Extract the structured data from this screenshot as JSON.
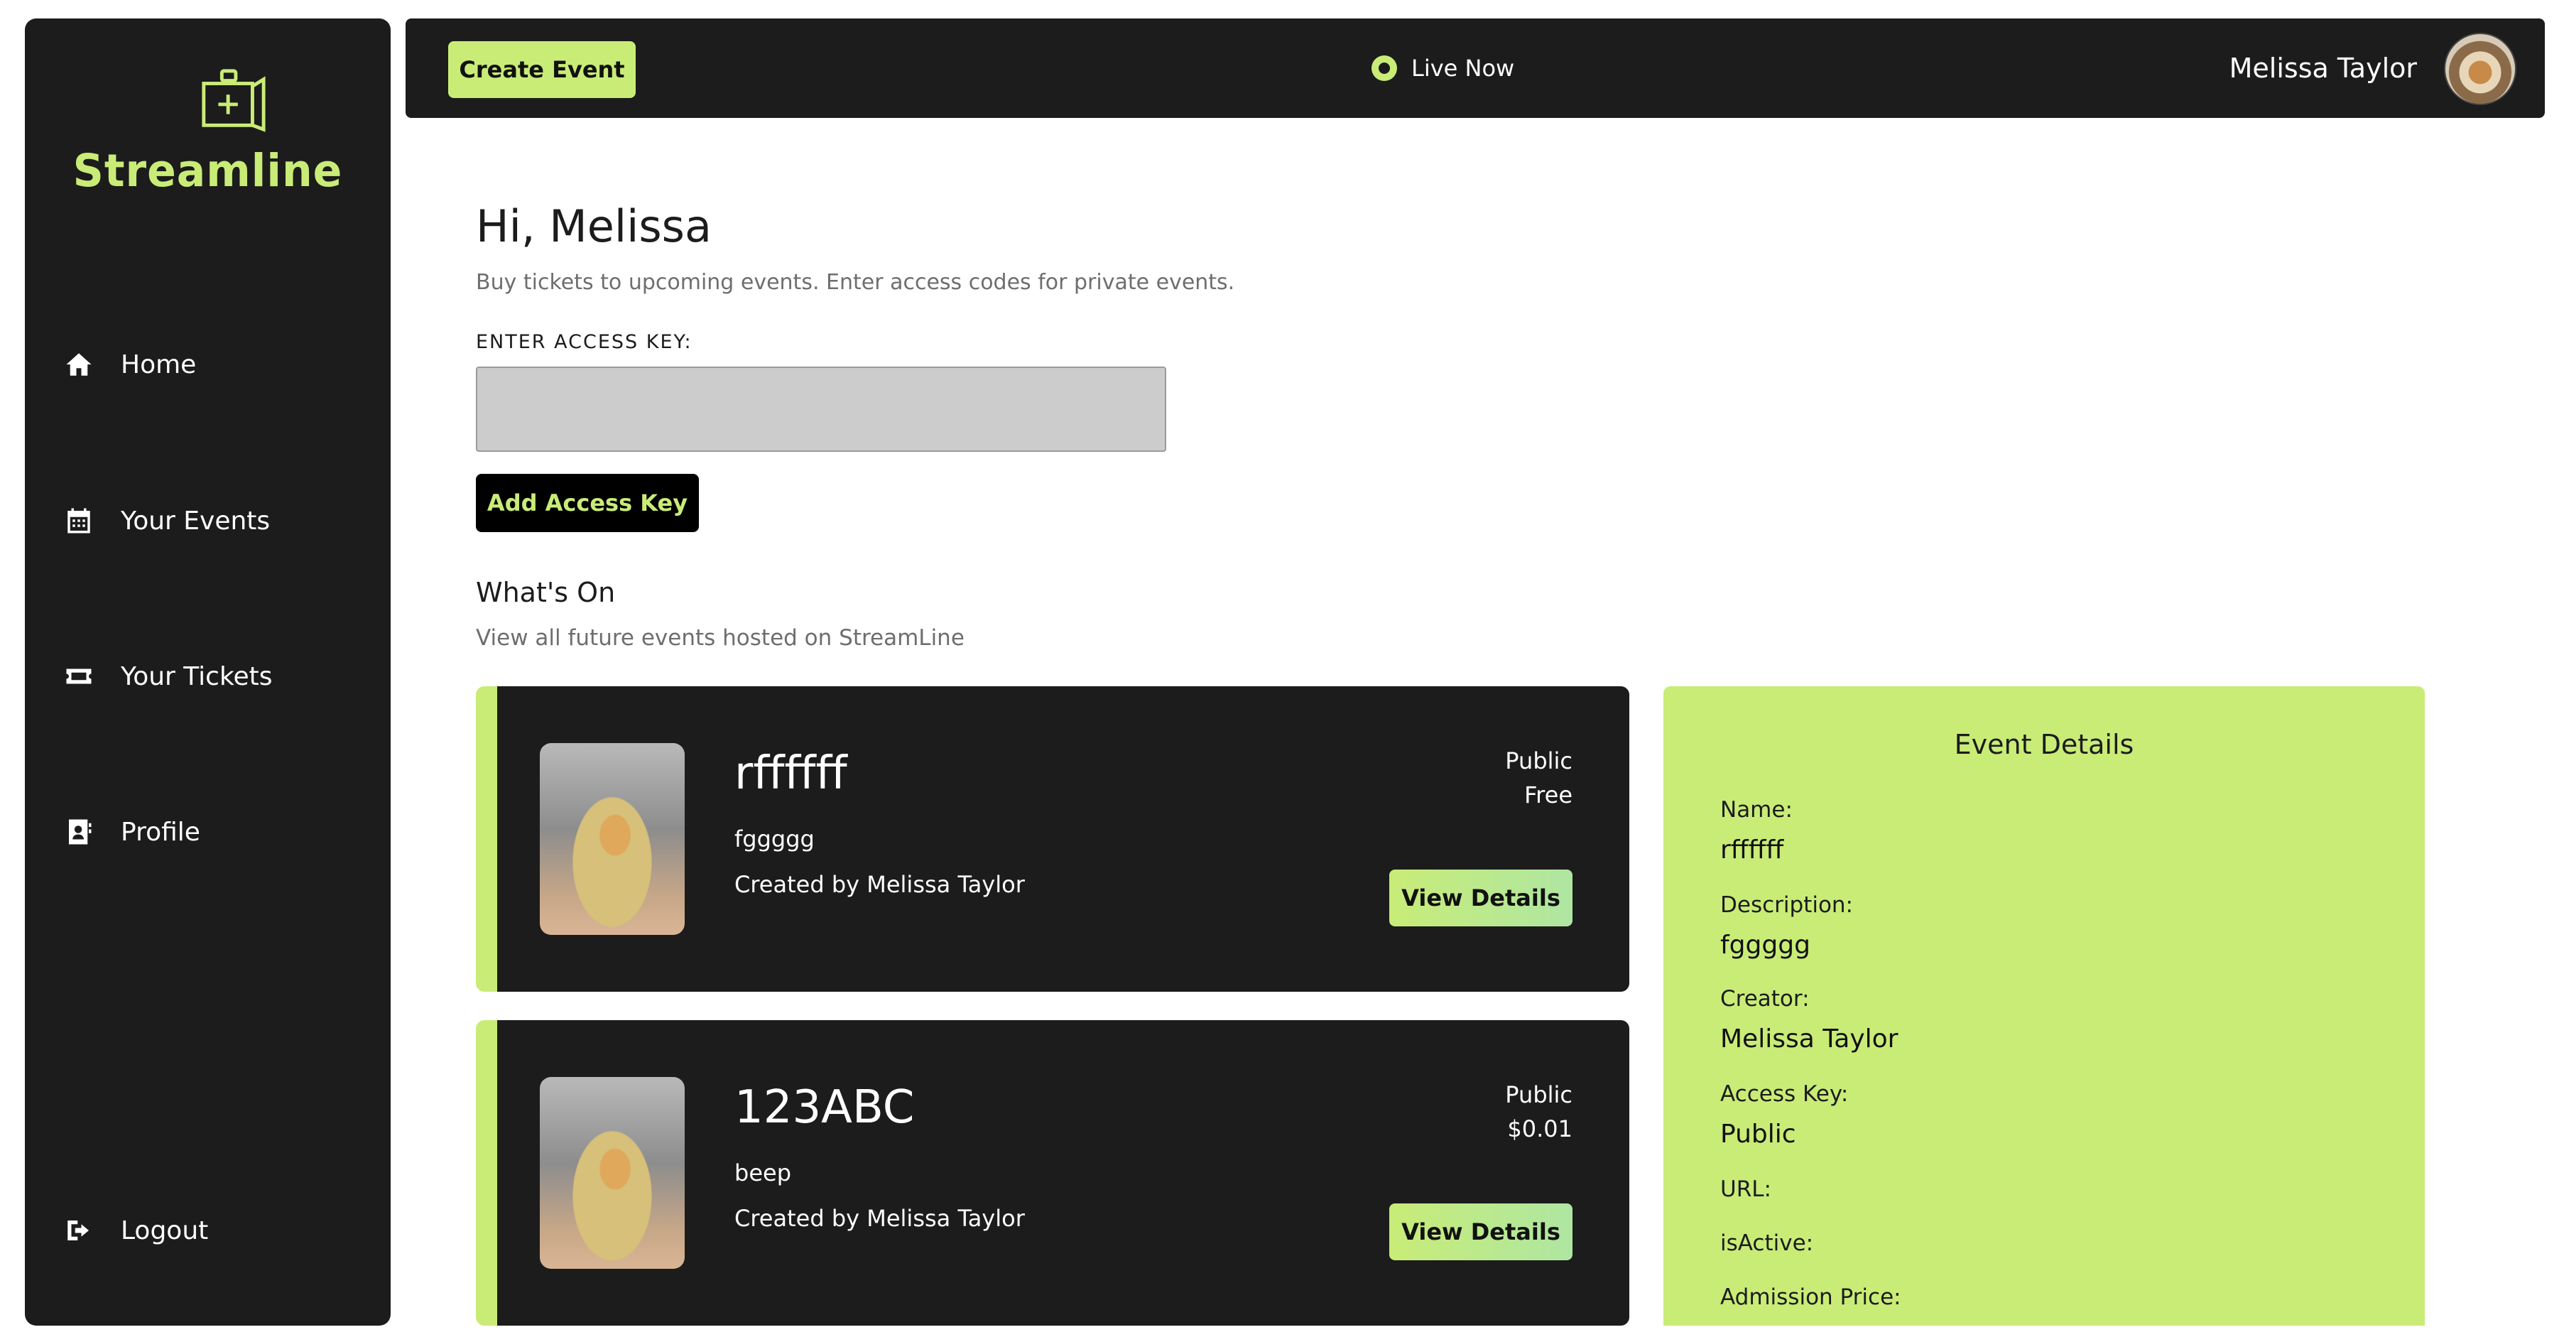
{
  "sidebar": {
    "logo_text": "Streamline",
    "items": [
      {
        "label": "Home",
        "icon": "home-icon"
      },
      {
        "label": "Your Events",
        "icon": "calendar-icon"
      },
      {
        "label": "Your Tickets",
        "icon": "ticket-icon"
      },
      {
        "label": "Profile",
        "icon": "contact-card-icon"
      },
      {
        "label": "Logout",
        "icon": "logout-icon"
      }
    ]
  },
  "header": {
    "create_label": "Create Event",
    "live_label": "Live Now",
    "user_name": "Melissa Taylor"
  },
  "main": {
    "greeting": "Hi, Melissa",
    "subtitle": "Buy tickets to upcoming events. Enter access codes for private events.",
    "access_label": "ENTER ACCESS KEY:",
    "access_value": "",
    "add_key_label": "Add Access Key",
    "section_title": "What's On",
    "section_sub": "View all future events hosted on StreamLine"
  },
  "events": [
    {
      "title": "rffffff",
      "description": "fggggg",
      "creator": "Created by Melissa Taylor",
      "visibility": "Public",
      "price": "Free",
      "button": "View Details"
    },
    {
      "title": "123ABC",
      "description": "beep",
      "creator": "Created by Melissa Taylor",
      "visibility": "Public",
      "price": "$0.01",
      "button": "View Details"
    }
  ],
  "details": {
    "title": "Event Details",
    "name_label": "Name:",
    "name_value": "rffffff",
    "desc_label": "Description:",
    "desc_value": "fggggg",
    "creator_label": "Creator:",
    "creator_value": "Melissa Taylor",
    "access_label": "Access Key:",
    "access_value": "Public",
    "url_label": "URL:",
    "active_label": "isActive:",
    "price_label": "Admission Price:"
  },
  "colors": {
    "accent": "#c9ec77",
    "dark": "#1c1c1c",
    "muted_text": "#6e6e6e"
  }
}
